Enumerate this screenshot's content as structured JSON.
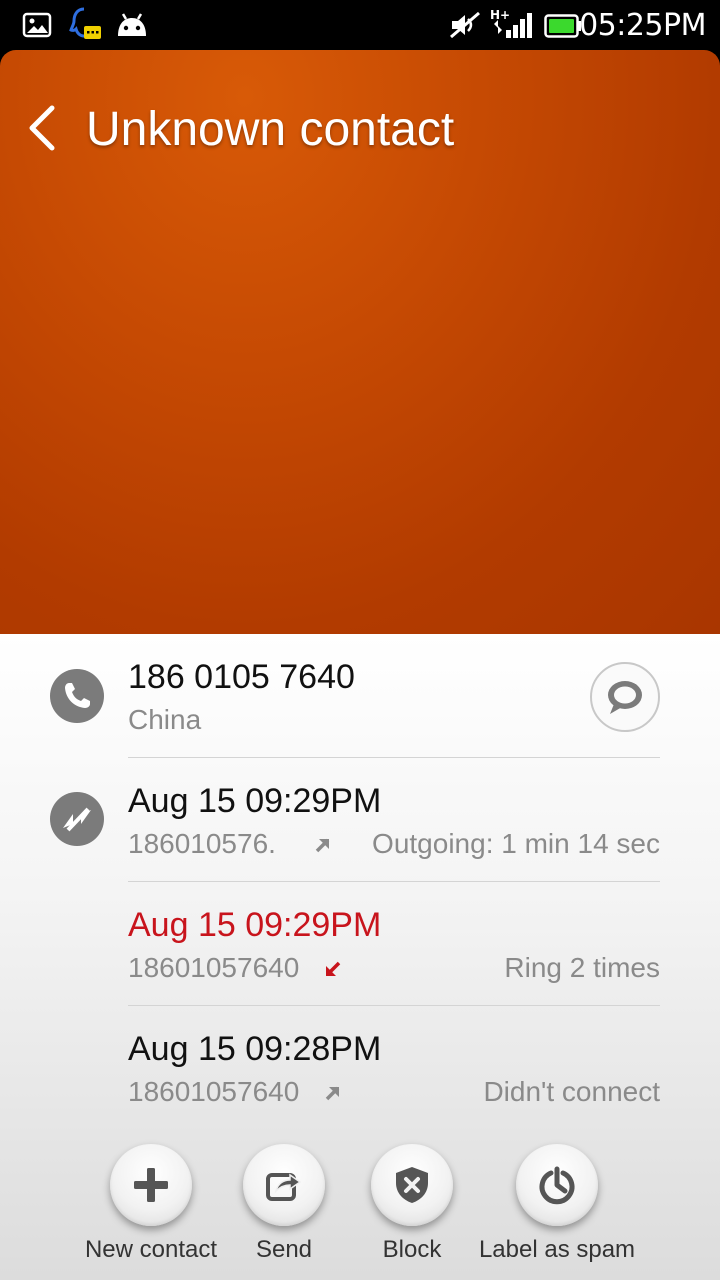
{
  "status_bar": {
    "time": "05:25PM",
    "left_icons": [
      "image-icon",
      "qq-chat-icon",
      "android-icon"
    ],
    "right_icons": [
      "muted-sound-icon",
      "hplus-signal-icon",
      "battery-icon"
    ],
    "network_label": "H+"
  },
  "header": {
    "title": "Unknown contact",
    "color": "#c44a04"
  },
  "contact": {
    "number": "186 0105 7640",
    "location": "China"
  },
  "calls": [
    {
      "time": "Aug 15 09:29PM",
      "number": "186010576.",
      "direction": "outgoing",
      "detail": "Outgoing: 1 min 14 sec",
      "missed": false
    },
    {
      "time": "Aug 15 09:29PM",
      "number": "18601057640",
      "direction": "incoming",
      "detail": "Ring 2 times",
      "missed": true
    },
    {
      "time": "Aug 15 09:28PM",
      "number": "18601057640",
      "direction": "outgoing",
      "detail": "Didn't connect",
      "missed": false
    }
  ],
  "actions": [
    {
      "label": "New contact",
      "icon": "plus-icon"
    },
    {
      "label": "Send",
      "icon": "share-icon"
    },
    {
      "label": "Block",
      "icon": "shield-block-icon"
    },
    {
      "label": "Label as spam",
      "icon": "spam-label-icon"
    }
  ],
  "colors": {
    "missed": "#c8141c",
    "secondary_text": "#8a8a8a",
    "accent": "#c44a04"
  }
}
